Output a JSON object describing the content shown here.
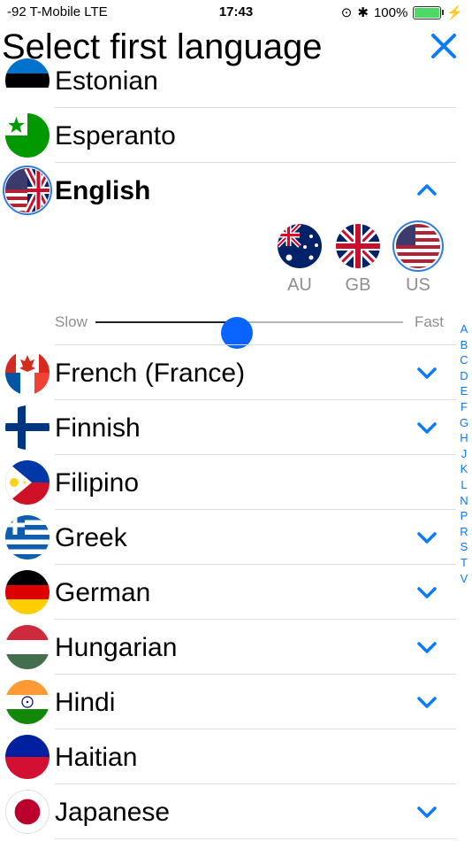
{
  "status_bar": {
    "carrier": "-92 T-Mobile  LTE",
    "time": "17:43",
    "battery_pct": "100%",
    "battery_level": 1.0
  },
  "header": {
    "title": "Select first language",
    "close_icon": "close-icon"
  },
  "colors": {
    "accent": "#0a7aff"
  },
  "languages": [
    {
      "name": "Estonian"
    },
    {
      "name": "Esperanto"
    },
    {
      "name": "English"
    },
    {
      "name": "French (France)"
    },
    {
      "name": "Finnish"
    },
    {
      "name": "Filipino"
    },
    {
      "name": "Greek"
    },
    {
      "name": "German"
    },
    {
      "name": "Hungarian"
    },
    {
      "name": "Hindi"
    },
    {
      "name": "Haitian"
    },
    {
      "name": "Japanese"
    }
  ],
  "variants": [
    {
      "label": "AU"
    },
    {
      "label": "GB"
    },
    {
      "label": "US"
    }
  ],
  "speed": {
    "slow": "Slow",
    "fast": "Fast",
    "value": 0.46
  },
  "index": [
    "A",
    "B",
    "C",
    "D",
    "E",
    "F",
    "G",
    "H",
    "J",
    "K",
    "L",
    "N",
    "P",
    "R",
    "S",
    "T",
    "V"
  ]
}
